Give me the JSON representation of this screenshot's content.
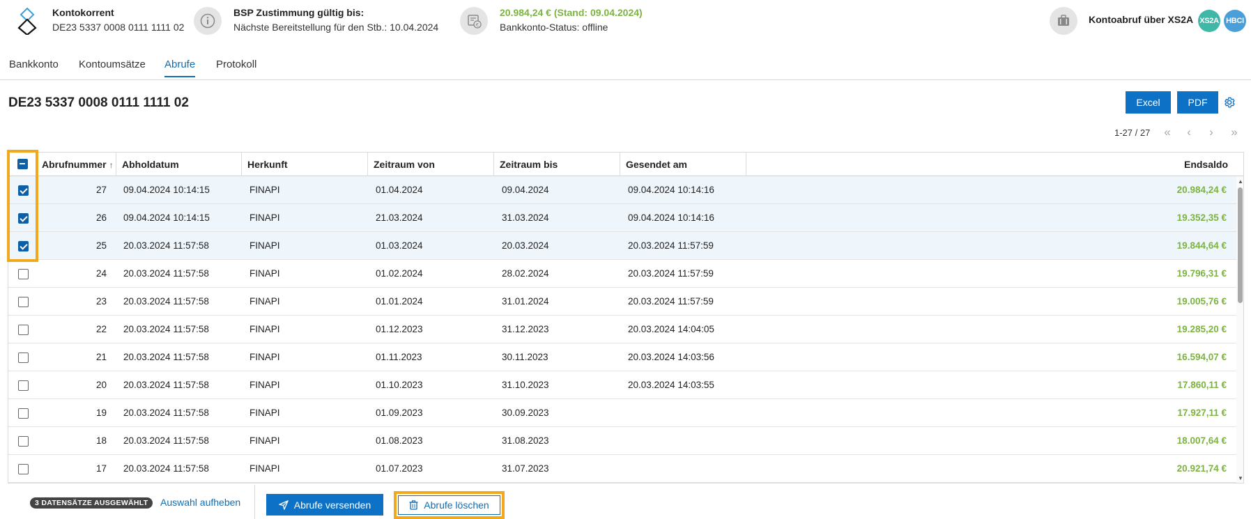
{
  "header": {
    "account_title": "Kontokorrent",
    "account_iban": "DE23 5337 0008 0111 1111 02",
    "bsp_title": "BSP Zustimmung gültig bis:",
    "bsp_sub": "Nächste Bereitstellung für den Stb.: 10.04.2024",
    "balance": "20.984,24 € (Stand: 09.04.2024)",
    "status": "Bankkonto-Status: offline",
    "kontoabruf": "Kontoabruf über XS2A",
    "badge_xs2a": "XS2A",
    "badge_hbci": "HBCI"
  },
  "tabs": [
    {
      "label": "Bankkonto",
      "active": false
    },
    {
      "label": "Kontoumsätze",
      "active": false
    },
    {
      "label": "Abrufe",
      "active": true
    },
    {
      "label": "Protokoll",
      "active": false
    }
  ],
  "main": {
    "title": "DE23 5337 0008 0111 1111 02",
    "excel_label": "Excel",
    "pdf_label": "PDF",
    "pager": "1-27 / 27"
  },
  "table": {
    "columns": [
      "Abrufnummer",
      "Abholdatum",
      "Herkunft",
      "Zeitraum von",
      "Zeitraum bis",
      "Gesendet am",
      "Endsaldo"
    ],
    "rows": [
      {
        "nr": "27",
        "abholdatum": "09.04.2024 10:14:15",
        "herkunft": "FINAPI",
        "von": "01.04.2024",
        "bis": "09.04.2024",
        "gesendet": "09.04.2024 10:14:16",
        "endsaldo": "20.984,24 €",
        "selected": true
      },
      {
        "nr": "26",
        "abholdatum": "09.04.2024 10:14:15",
        "herkunft": "FINAPI",
        "von": "21.03.2024",
        "bis": "31.03.2024",
        "gesendet": "09.04.2024 10:14:16",
        "endsaldo": "19.352,35 €",
        "selected": true
      },
      {
        "nr": "25",
        "abholdatum": "20.03.2024 11:57:58",
        "herkunft": "FINAPI",
        "von": "01.03.2024",
        "bis": "20.03.2024",
        "gesendet": "20.03.2024 11:57:59",
        "endsaldo": "19.844,64 €",
        "selected": true
      },
      {
        "nr": "24",
        "abholdatum": "20.03.2024 11:57:58",
        "herkunft": "FINAPI",
        "von": "01.02.2024",
        "bis": "28.02.2024",
        "gesendet": "20.03.2024 11:57:59",
        "endsaldo": "19.796,31 €",
        "selected": false
      },
      {
        "nr": "23",
        "abholdatum": "20.03.2024 11:57:58",
        "herkunft": "FINAPI",
        "von": "01.01.2024",
        "bis": "31.01.2024",
        "gesendet": "20.03.2024 11:57:59",
        "endsaldo": "19.005,76 €",
        "selected": false
      },
      {
        "nr": "22",
        "abholdatum": "20.03.2024 11:57:58",
        "herkunft": "FINAPI",
        "von": "01.12.2023",
        "bis": "31.12.2023",
        "gesendet": "20.03.2024 14:04:05",
        "endsaldo": "19.285,20 €",
        "selected": false
      },
      {
        "nr": "21",
        "abholdatum": "20.03.2024 11:57:58",
        "herkunft": "FINAPI",
        "von": "01.11.2023",
        "bis": "30.11.2023",
        "gesendet": "20.03.2024 14:03:56",
        "endsaldo": "16.594,07 €",
        "selected": false
      },
      {
        "nr": "20",
        "abholdatum": "20.03.2024 11:57:58",
        "herkunft": "FINAPI",
        "von": "01.10.2023",
        "bis": "31.10.2023",
        "gesendet": "20.03.2024 14:03:55",
        "endsaldo": "17.860,11 €",
        "selected": false
      },
      {
        "nr": "19",
        "abholdatum": "20.03.2024 11:57:58",
        "herkunft": "FINAPI",
        "von": "01.09.2023",
        "bis": "30.09.2023",
        "gesendet": "",
        "endsaldo": "17.927,11 €",
        "selected": false
      },
      {
        "nr": "18",
        "abholdatum": "20.03.2024 11:57:58",
        "herkunft": "FINAPI",
        "von": "01.08.2023",
        "bis": "31.08.2023",
        "gesendet": "",
        "endsaldo": "18.007,64 €",
        "selected": false
      },
      {
        "nr": "17",
        "abholdatum": "20.03.2024 11:57:58",
        "herkunft": "FINAPI",
        "von": "01.07.2023",
        "bis": "31.07.2023",
        "gesendet": "",
        "endsaldo": "20.921,74 €",
        "selected": false
      }
    ]
  },
  "footer": {
    "selected_badge": "3 DATENSÄTZE AUSGEWÄHLT",
    "deselect_label": "Auswahl aufheben",
    "send_label": "Abrufe versenden",
    "delete_label": "Abrufe löschen"
  },
  "colors": {
    "accent": "#0d72c5",
    "positive": "#7cb342",
    "highlight": "#f2a81d",
    "selected_row": "#eef5fb"
  }
}
